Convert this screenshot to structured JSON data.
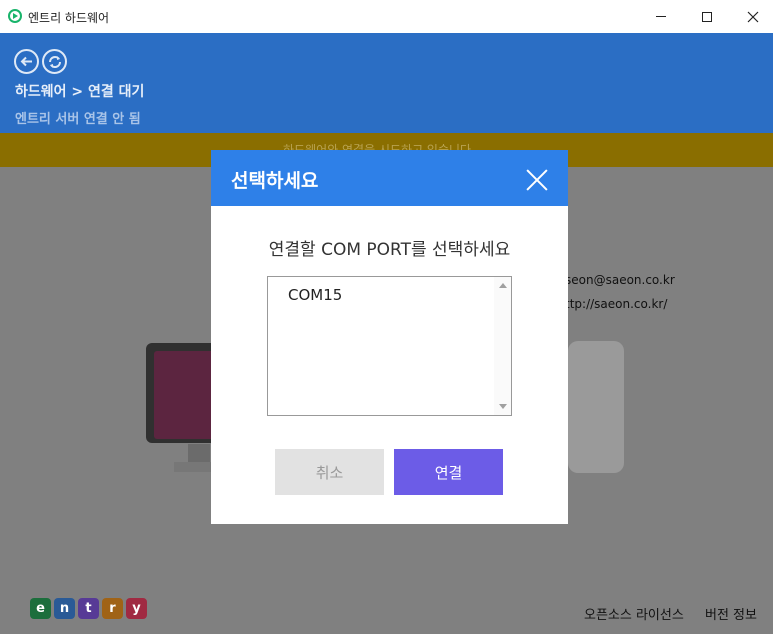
{
  "window": {
    "title": "엔트리 하드웨어",
    "controls": {
      "minimize": "minimize",
      "maximize": "maximize",
      "close": "close"
    }
  },
  "header": {
    "breadcrumb": "하드웨어 > 연결 대기",
    "server_status": "엔트리 서버 연결 안 됨",
    "back_icon": "←",
    "refresh_icon": "⟳"
  },
  "notice": {
    "text": "하드웨어와 연결을 시도하고 있습니다"
  },
  "contact": {
    "email": "seon@saeon.co.kr",
    "url": "ttp://saeon.co.kr/"
  },
  "brand": {
    "letters": [
      "e",
      "n",
      "t",
      "r",
      "y"
    ],
    "colors": [
      "#1c9c54",
      "#3a7fd6",
      "#7b4fd8",
      "#e88a1e",
      "#e83a5c"
    ]
  },
  "footer": {
    "license": "오픈소스 라이선스",
    "version": "버전 정보"
  },
  "modal": {
    "title": "선택하세요",
    "prompt": "연결할 COM PORT를 선택하세요",
    "ports": [
      "COM15"
    ],
    "cancel_label": "취소",
    "connect_label": "연결"
  },
  "colors": {
    "header_bg": "#2b6ec4",
    "modal_header": "#2e80e8",
    "connect_button": "#6c5ce7",
    "notice_bar": "#8a6e00"
  }
}
